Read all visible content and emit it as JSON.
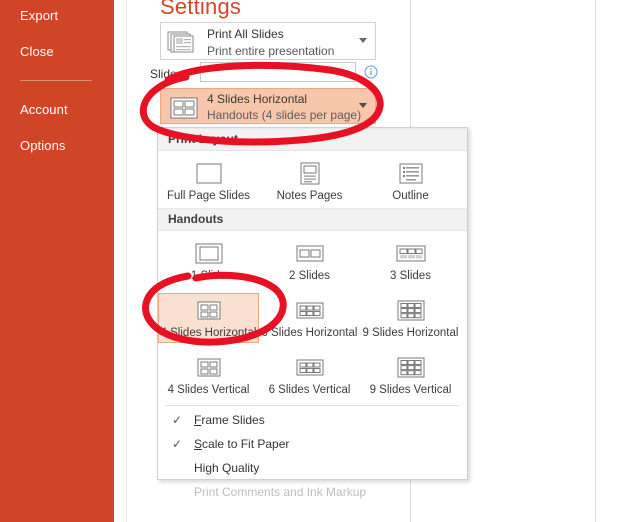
{
  "sidebar": {
    "background_color": "#cf4526",
    "items": [
      {
        "label": "Export",
        "name": "export"
      },
      {
        "label": "Close",
        "name": "close"
      },
      {
        "label": "Account",
        "name": "account"
      },
      {
        "label": "Options",
        "name": "options"
      }
    ]
  },
  "settings": {
    "title": "Settings",
    "print_range": {
      "main": "Print All Slides",
      "sub": "Print entire presentation",
      "icon": "print-all-slides-icon"
    },
    "slides_field": {
      "label": "Slides:",
      "value": "",
      "placeholder": "",
      "info_icon": "info-icon"
    },
    "layout_combo": {
      "main": "4 Slides Horizontal",
      "sub": "Handouts (4 slides per page)",
      "icon": "four-slides-horizontal-icon",
      "highlight_color": "#f7c6ab"
    }
  },
  "layout_panel": {
    "sections": [
      {
        "heading": "Print Layout",
        "name": "print-layout",
        "tiles": [
          {
            "label": "Full Page Slides",
            "icon": "full-page-slide-icon",
            "selected": false
          },
          {
            "label": "Notes Pages",
            "icon": "notes-page-icon",
            "selected": false
          },
          {
            "label": "Outline",
            "icon": "outline-icon",
            "selected": false
          }
        ]
      },
      {
        "heading": "Handouts",
        "name": "handouts",
        "rows": [
          [
            {
              "label": "1 Slide",
              "icon": "handout-1-icon",
              "selected": false
            },
            {
              "label": "2 Slides",
              "icon": "handout-2-icon",
              "selected": false
            },
            {
              "label": "3 Slides",
              "icon": "handout-3-icon",
              "selected": false
            }
          ],
          [
            {
              "label": "4 Slides Horizontal",
              "icon": "handout-4h-icon",
              "selected": true
            },
            {
              "label": "6 Slides Horizontal",
              "icon": "handout-6h-icon",
              "selected": false
            },
            {
              "label": "9 Slides Horizontal",
              "icon": "handout-9h-icon",
              "selected": false
            }
          ],
          [
            {
              "label": "4 Slides Vertical",
              "icon": "handout-4v-icon",
              "selected": false
            },
            {
              "label": "6 Slides Vertical",
              "icon": "handout-6v-icon",
              "selected": false
            },
            {
              "label": "9 Slides Vertical",
              "icon": "handout-9v-icon",
              "selected": false
            }
          ]
        ]
      }
    ],
    "options": [
      {
        "label": "Frame Slides",
        "checked": true,
        "disabled": false,
        "accel": "F"
      },
      {
        "label": "Scale to Fit Paper",
        "checked": true,
        "disabled": false,
        "accel": "S"
      },
      {
        "label": "High Quality",
        "checked": false,
        "disabled": false,
        "accel": ""
      },
      {
        "label": "Print Comments and Ink Markup",
        "checked": false,
        "disabled": true,
        "accel": ""
      }
    ],
    "check_glyph": "✓"
  },
  "annotations": {
    "color": "#e81123",
    "shapes": [
      {
        "name": "circle-around-layout-combo",
        "description": "hand drawn red ellipse around 4 Slides Horizontal dropdown"
      },
      {
        "name": "circle-around-selected-tile",
        "description": "hand drawn red ellipse around 4 Slides Horizontal handout tile"
      }
    ]
  }
}
